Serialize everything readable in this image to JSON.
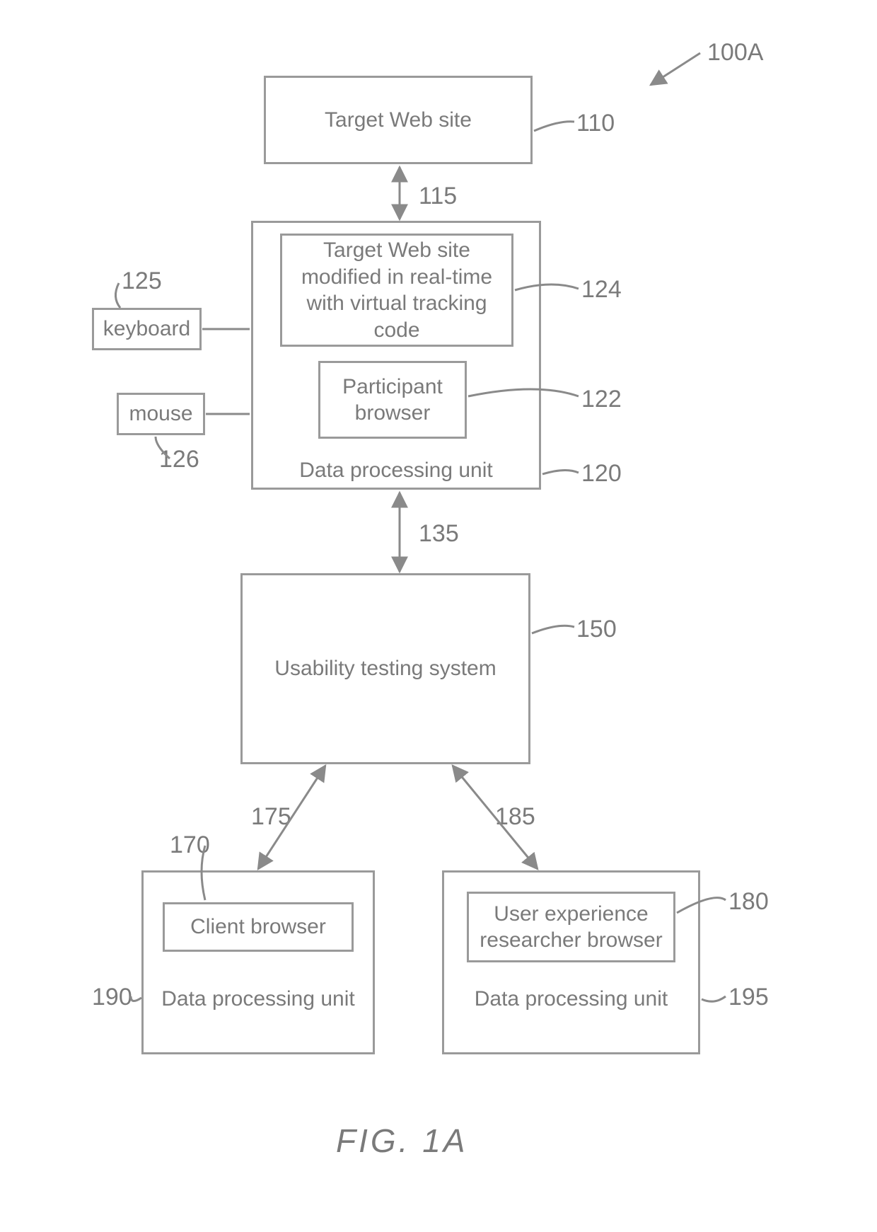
{
  "figure_ref": "100A",
  "caption": "FIG. 1A",
  "boxes": {
    "b110": {
      "text": "Target Web site"
    },
    "b124": {
      "text": "Target Web site modified in real-time with virtual tracking code"
    },
    "b122": {
      "text": "Participant browser"
    },
    "b120_caption": "Data processing unit",
    "b125": {
      "text": "keyboard"
    },
    "b126": {
      "text": "mouse"
    },
    "b150": {
      "text": "Usability testing system"
    },
    "b170": {
      "text": "Client browser"
    },
    "b190_caption": "Data processing unit",
    "b180": {
      "text": "User experience researcher browser"
    },
    "b195_caption": "Data processing unit"
  },
  "labels": {
    "l100A": "100A",
    "l110": "110",
    "l115": "115",
    "l125": "125",
    "l124": "124",
    "l122": "122",
    "l120": "120",
    "l126": "126",
    "l135": "135",
    "l150": "150",
    "l170": "170",
    "l175": "175",
    "l185": "185",
    "l190": "190",
    "l180": "180",
    "l195": "195"
  }
}
